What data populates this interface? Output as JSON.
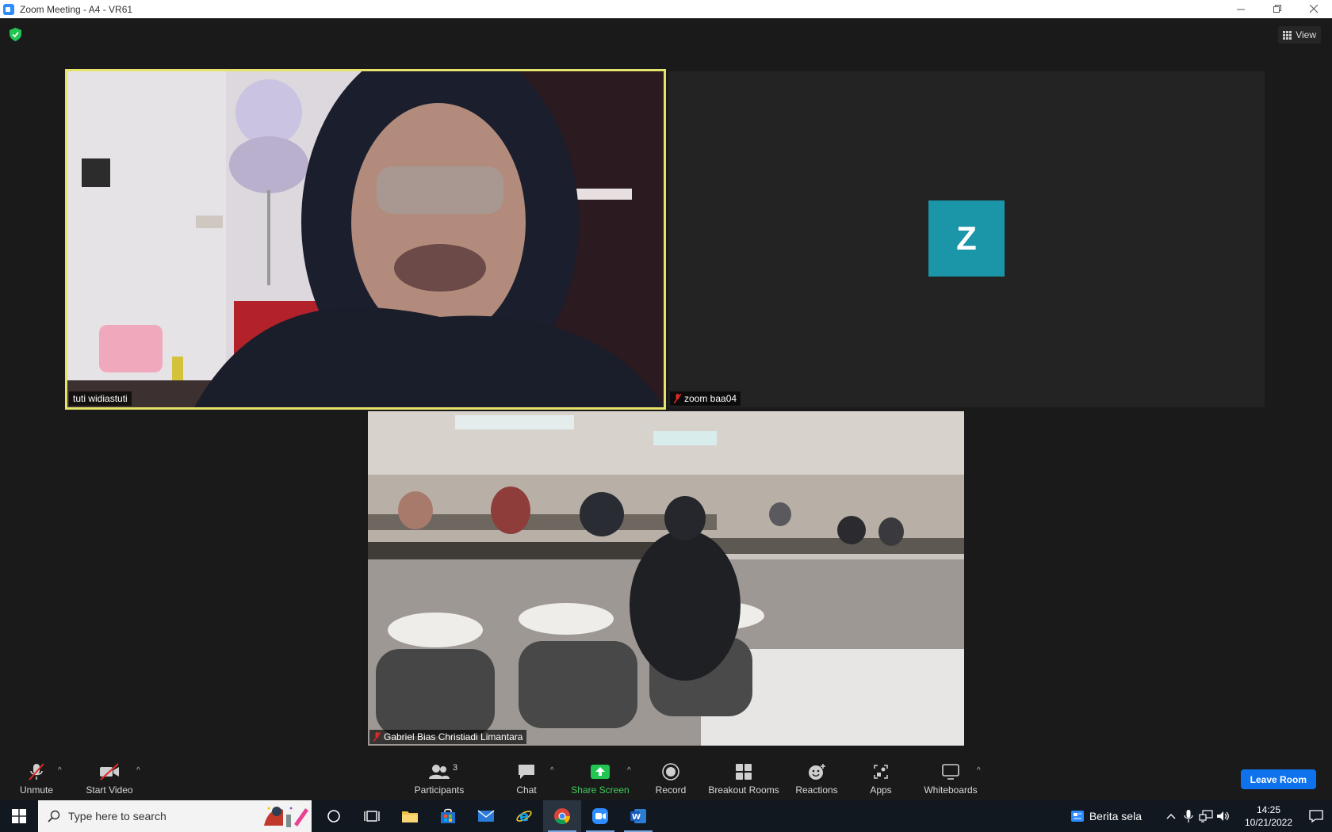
{
  "window": {
    "title": "Zoom Meeting - A4 - VR61"
  },
  "header": {
    "view_label": "View"
  },
  "participants_tiles": [
    {
      "name": "tuti widiastuti",
      "active_speaker": true,
      "muted": false
    },
    {
      "name": "zoom baa04",
      "avatar_letter": "Z",
      "muted": true
    },
    {
      "name": "Gabriel Bias Christiadi Limantara",
      "muted": true
    }
  ],
  "toolbar": {
    "unmute": "Unmute",
    "start_video": "Start Video",
    "participants": "Participants",
    "participants_count": "3",
    "chat": "Chat",
    "share_screen": "Share Screen",
    "record": "Record",
    "breakout_rooms": "Breakout Rooms",
    "reactions": "Reactions",
    "apps": "Apps",
    "whiteboards": "Whiteboards",
    "leave": "Leave Room"
  },
  "taskbar": {
    "search_placeholder": "Type here to search",
    "news": "Berita sela",
    "time": "14:25",
    "date": "10/21/2022"
  },
  "colors": {
    "active_speaker_border": "#e5e36a",
    "avatar_bg": "#1b95a8",
    "share_green": "#3ecf5c",
    "leave_blue": "#0e72ed"
  }
}
